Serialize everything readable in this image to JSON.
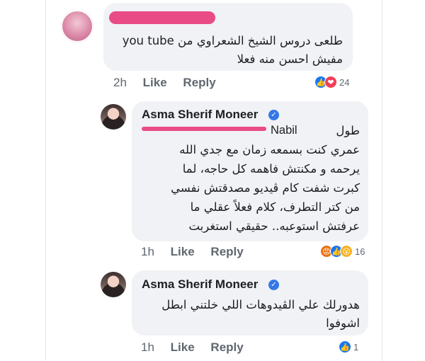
{
  "comments": [
    {
      "author_redacted": true,
      "message_lines": [
        "طلعى دروس الشيخ  الشعراوي من you tube",
        "مفيش احسن منه فعلا"
      ],
      "time": "2h",
      "like_label": "Like",
      "reply_label": "Reply",
      "reactions": [
        "like-icon",
        "love-icon"
      ],
      "reaction_count": "24"
    },
    {
      "author": "Asma Sherif Moneer",
      "verified": true,
      "mention_visible": "Nabil",
      "message_lines": [
        "طول",
        "عمري كنت بسمعه زمان مع جدي الله",
        "يرحمه و مكنتش فاهمه كل حاجه، لما",
        "كبرت شفت كام ڤيديو مصدقتش نفسي",
        "من كتر التطرف، كلام فعلاً عقلي ما",
        "عرفتش استوعبه.. حقيقي استغربت"
      ],
      "time": "1h",
      "like_label": "Like",
      "reply_label": "Reply",
      "reactions": [
        "angry-icon",
        "like-icon",
        "wow-icon"
      ],
      "reaction_count": "16"
    },
    {
      "author": "Asma Sherif Moneer",
      "verified": true,
      "message_lines": [
        "هدورلك علي الڤيدوهات اللي خلتني ابطل",
        "اشوفوا"
      ],
      "time": "1h",
      "like_label": "Like",
      "reply_label": "Reply",
      "reactions": [
        "like-icon"
      ],
      "reaction_count": "1"
    }
  ],
  "colors": {
    "bubble": "#f0f2f5",
    "redaction": "#e94b87",
    "like": "#1877f2",
    "meta": "#606770"
  }
}
